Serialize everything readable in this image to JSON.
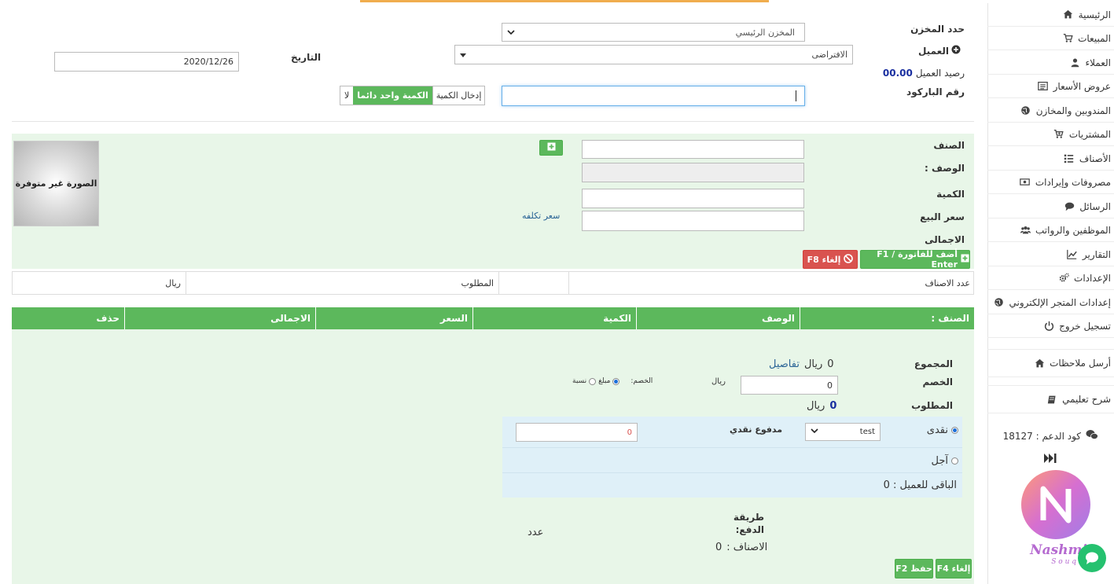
{
  "sidebar": {
    "items": [
      {
        "label": "الرئيسية",
        "icon": "home-icon"
      },
      {
        "label": "المبيعات",
        "icon": "cart-icon"
      },
      {
        "label": "العملاء",
        "icon": "user-icon"
      },
      {
        "label": "عروض الأسعار",
        "icon": "list-box-icon"
      },
      {
        "label": "المندوبين والمخازن",
        "icon": "globe-icon"
      },
      {
        "label": "المشتريات",
        "icon": "cart-add-icon"
      },
      {
        "label": "الأصناف",
        "icon": "list-icon"
      },
      {
        "label": "مصروفات وإيرادات",
        "icon": "money-icon"
      },
      {
        "label": "الرسائل",
        "icon": "chat-icon"
      },
      {
        "label": "الموظفين والرواتب",
        "icon": "users-icon"
      },
      {
        "label": "التقارير",
        "icon": "chart-icon"
      },
      {
        "label": "الإعدادات",
        "icon": "cogs-icon"
      },
      {
        "label": "إعدادات المتجر الإلكتروني",
        "icon": "globe-icon"
      },
      {
        "label": "تسجيل خروج",
        "icon": "power-icon"
      }
    ],
    "feedback": "أرسل ملاحظات",
    "tutorial": "شرح تعليمي",
    "support_code": "كود الدعم : 18127",
    "brand": "Nashmi",
    "brand_sub": "S o u q"
  },
  "header": {
    "warehouse_label": "حدد المخزن",
    "warehouse_value": "المخزن الرئيسي",
    "customer_label": "العميل",
    "customer_value": "الافتراضى",
    "date_label": "التاريخ",
    "date_value": "2020/12/26",
    "balance_label": "رصيد العميل",
    "balance_value": "00.00",
    "barcode_label": "رقم الباركود",
    "qty_entry": "إدخال الكمية",
    "qty_one": "الكمية واحد دائما",
    "qty_no": "لا"
  },
  "item_form": {
    "item_label": "الصنف",
    "desc_label": "الوصف :",
    "qty_label": "الكمية",
    "price_label": "سعر البيع",
    "total_label": "الاجمالى",
    "cost_link": "سعر تكلفه",
    "image_text": "الصورة غير متوفرة",
    "add_btn": "أضف للفاتورة F1 / Enter",
    "cancel_btn": "إلغاء F8"
  },
  "summary_row": {
    "count_label": "عدد الاصناف",
    "required_label": "المطلوب",
    "currency": "ريال"
  },
  "table": {
    "headers": [
      "الصنف :",
      "الوصف",
      "الكمية",
      "السعر",
      "الاجمالى",
      "حذف"
    ]
  },
  "totals": {
    "sum_label": "المجموع",
    "sum_value": "0",
    "currency": "ريال",
    "details_link": "تفاصيل",
    "discount_label": "الخصم",
    "discount_value": "0",
    "discount_type_label": "الخصم:",
    "discount_amount": "مبلغ",
    "discount_percent": "نسبة",
    "required_label": "المطلوب",
    "required_value": "0"
  },
  "payment": {
    "cash_label": "نقدى",
    "cash_account": "test",
    "cash_paid_label": "مدفوع نقدي",
    "cash_paid_value": "0",
    "credit_label": "آجل",
    "remaining": "الباقى للعميل : 0",
    "method_label": "طريقة الدفع:",
    "items_count_label": "الاصناف :",
    "items_count_value": "0",
    "count_word": "عدد",
    "save_btn": "حفظ F2",
    "cancel_btn": "إلغاء F4"
  }
}
